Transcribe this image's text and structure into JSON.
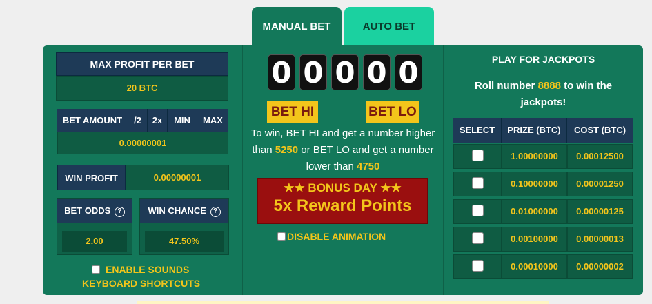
{
  "tabs": [
    {
      "label": "MANUAL BET",
      "active": true
    },
    {
      "label": "AUTO BET",
      "active": false
    }
  ],
  "left": {
    "max_profit_label": "MAX PROFIT PER BET",
    "max_profit_value": "20 BTC",
    "bet_amount_label": "BET AMOUNT",
    "half_label": "/2",
    "double_label": "2x",
    "min_label": "MIN",
    "max_label": "MAX",
    "bet_amount_value": "0.00000001",
    "win_profit_label": "WIN PROFIT",
    "win_profit_value": "0.00000001",
    "bet_odds_label": "BET ODDS",
    "bet_odds_value": "2.00",
    "win_chance_label": "WIN CHANCE",
    "win_chance_value": "47.50%",
    "help_glyph": "?",
    "enable_sounds_label": "ENABLE SOUNDS",
    "keyboard_shortcuts_label": "KEYBOARD SHORTCUTS"
  },
  "center": {
    "digits": [
      "0",
      "0",
      "0",
      "0",
      "0"
    ],
    "bet_hi_label": "BET HI",
    "bet_lo_label": "BET LO",
    "info_1": "To win, BET HI and get a number higher than ",
    "hi_threshold": "5250",
    "info_2": " or BET LO and get a number lower than ",
    "lo_threshold": "4750",
    "bonus_title": "BONUS DAY",
    "bonus_stars_left": "★★",
    "bonus_stars_right": "★★",
    "bonus_reward": "5x Reward Points",
    "disable_animation_label": "DISABLE ANIMATION"
  },
  "jackpots": {
    "title": "PLAY FOR JACKPOTS",
    "roll_text_1": "Roll number ",
    "roll_number": "8888",
    "roll_text_2": " to win the jackpots!",
    "headers": [
      "SELECT",
      "PRIZE (BTC)",
      "COST (BTC)"
    ],
    "rows": [
      {
        "prize": "1.00000000",
        "cost": "0.00012500"
      },
      {
        "prize": "0.10000000",
        "cost": "0.00001250"
      },
      {
        "prize": "0.01000000",
        "cost": "0.00000125"
      },
      {
        "prize": "0.00100000",
        "cost": "0.00000013"
      },
      {
        "prize": "0.00010000",
        "cost": "0.00000002"
      }
    ]
  },
  "colors": {
    "panel": "#13785a",
    "navy": "#1e3a57",
    "accent_yellow": "#f3c51b",
    "bonus_red": "#9a0f0f",
    "auto_tab": "#1bd1a0"
  }
}
